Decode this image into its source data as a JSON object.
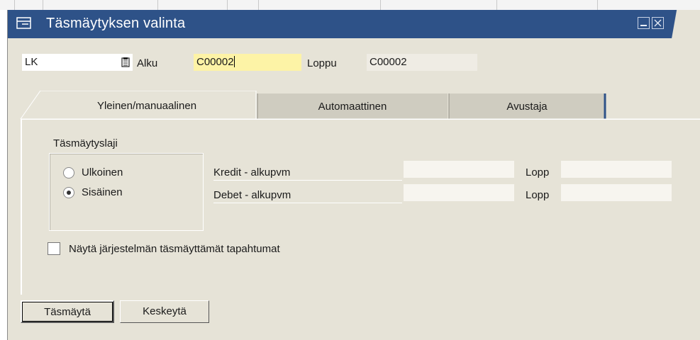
{
  "window": {
    "title": "Täsmäytyksen valinta"
  },
  "header": {
    "type_value": "LK",
    "start_label": "Alku",
    "start_value": "C00002",
    "end_label": "Loppu",
    "end_value": "C00002"
  },
  "tabs": [
    {
      "label": "Yleinen/manuaalinen",
      "active": true
    },
    {
      "label": "Automaattinen",
      "active": false
    },
    {
      "label": "Avustaja",
      "active": false
    }
  ],
  "general": {
    "group_title": "Täsmäytyslaji",
    "radio_external": "Ulkoinen",
    "radio_internal": "Sisäinen",
    "selected": "Sisäinen",
    "credit_label": "Kredit - alkupvm",
    "credit_start": "",
    "credit_end_label": "Lopp",
    "credit_end": "",
    "debit_label": "Debet - alkupvm",
    "debit_start": "",
    "debit_end_label": "Lopp",
    "debit_end": "",
    "show_system_label": "Näytä järjestelmän täsmäyttämät tapahtumat",
    "show_system_checked": false
  },
  "buttons": {
    "ok": "Täsmäytä",
    "cancel": "Keskeytä"
  },
  "colors": {
    "title_bar": "#2e5288",
    "window_bg": "#e6e3d7",
    "highlight_field": "#fdf3a6"
  }
}
